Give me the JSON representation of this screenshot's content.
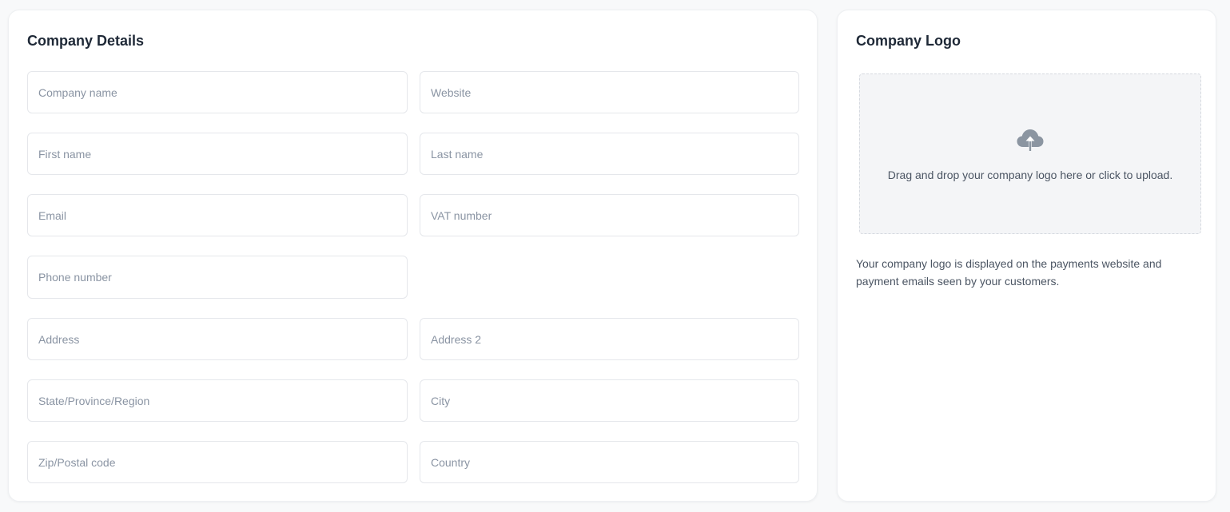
{
  "details": {
    "title": "Company Details",
    "fields": {
      "company_name": "Company name",
      "website": "Website",
      "first_name": "First name",
      "last_name": "Last name",
      "email": "Email",
      "vat_number": "VAT number",
      "phone_number": "Phone number",
      "address": "Address",
      "address2": "Address 2",
      "state": "State/Province/Region",
      "city": "City",
      "zip": "Zip/Postal code",
      "country": "Country"
    }
  },
  "logo": {
    "title": "Company Logo",
    "upload_icon": "cloud-upload-icon",
    "dropzone_text": "Drag and drop your company logo here or click to upload.",
    "help_text": "Your company logo is displayed on the payments website and payment emails seen by your customers."
  },
  "colors": {
    "page_background": "#f8f9fa",
    "card_background": "#ffffff",
    "border": "#e5e7eb",
    "placeholder": "#8a94a3",
    "title_text": "#1f2937",
    "icon": "#8b95a1"
  }
}
